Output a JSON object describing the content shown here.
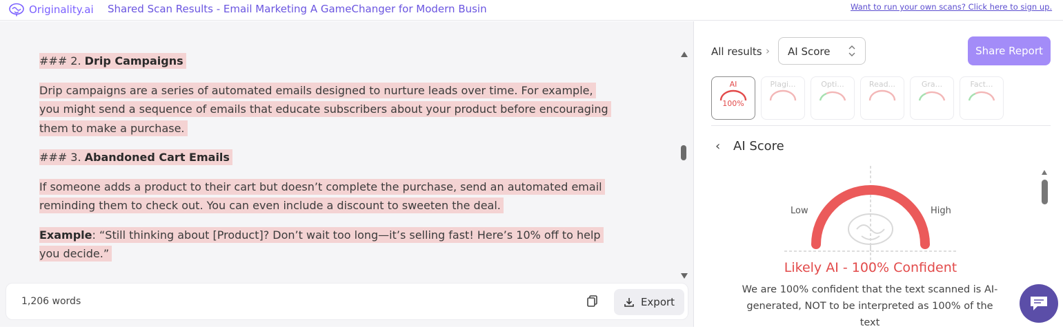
{
  "header": {
    "brand": "Originality.ai",
    "title": "Shared Scan Results - Email Marketing A GameChanger for Modern Busin",
    "signup_link": "Want to run your own scans? Click here to sign up."
  },
  "document": {
    "blocks": [
      {
        "prefix": "### 2. ",
        "bold": "Drip Campaigns"
      },
      {
        "text": "Drip campaigns are a series of automated emails designed to nurture leads over time. For example, you might send a sequence of emails that educate subscribers about your product before encouraging them to make a purchase."
      },
      {
        "prefix": "### 3. ",
        "bold": "Abandoned Cart Emails"
      },
      {
        "text": "If someone adds a product to their cart but doesn’t complete the purchase, send an automated email reminding them to check out. You can even include a discount to sweeten the deal."
      },
      {
        "bold_lead": "Example",
        "text": ": “Still thinking about [Product]? Don’t wait too long—it’s selling fast! Here’s 10% off to help you decide.”"
      }
    ],
    "word_count": "1,206 words",
    "export_label": "Export"
  },
  "results": {
    "breadcrumb": "All results",
    "breadcrumb_separator": "›",
    "selected_view": "AI Score",
    "share_label": "Share Report",
    "tabs": [
      {
        "label": "AI",
        "value": "100%",
        "active": true,
        "arc_color": "#e24a4a"
      },
      {
        "label": "Plagi...",
        "value": "",
        "active": false,
        "arc_color": "#f3b7b7"
      },
      {
        "label": "Opti...",
        "value": "",
        "active": false,
        "arc_color": "#f3b7b7"
      },
      {
        "label": "Read...",
        "value": "",
        "active": false,
        "arc_color": "#f3b7b7"
      },
      {
        "label": "Gra...",
        "value": "",
        "active": false,
        "arc_color": "#f3b7b7"
      },
      {
        "label": "Fact...",
        "value": "",
        "active": false,
        "arc_color": "#f3b7b7"
      }
    ],
    "panel_title": "AI Score",
    "gauge": {
      "low_label": "Low",
      "high_label": "High",
      "score_percent": 100,
      "color": "#e24a4a"
    },
    "verdict": "Likely AI - 100% Confident",
    "description": "We are 100% confident that the text scanned is AI-generated, NOT to be interpreted as 100% of the text"
  },
  "colors": {
    "accent": "#a38cf8",
    "ai_red": "#e24a4a",
    "highlight": "#f4d3d3",
    "brand": "#7b61ff"
  },
  "icons": [
    "brain-logo-icon",
    "copy-icon",
    "download-icon",
    "chevron-right-icon",
    "updown-chevron-icon",
    "back-chevron-icon",
    "chat-icon"
  ]
}
